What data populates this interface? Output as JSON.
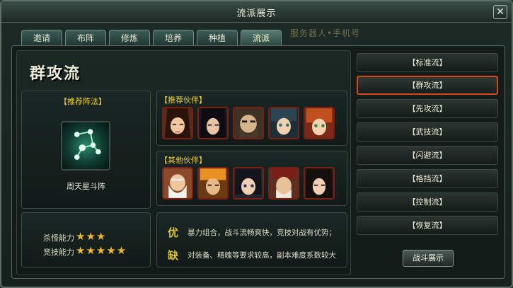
{
  "window": {
    "title": "流派展示",
    "close_icon": "close-icon"
  },
  "tabs": [
    {
      "label": "邀请"
    },
    {
      "label": "布阵"
    },
    {
      "label": "修炼"
    },
    {
      "label": "培养"
    },
    {
      "label": "种植"
    },
    {
      "label": "流派",
      "active": true
    }
  ],
  "background_text": "服务器人•手机号",
  "main": {
    "style_title": "群攻流",
    "recommended_formation": {
      "label": "【推荐阵法】",
      "name": "周天星斗阵"
    },
    "recommended_partners": {
      "label": "【推荐伙伴】",
      "count": 5
    },
    "other_partners": {
      "label": "【其他伙伴】",
      "count": 5
    },
    "ratings": [
      {
        "label": "杀怪能力",
        "stars": 3,
        "display": "★★★"
      },
      {
        "label": "竞技能力",
        "stars": 5,
        "display": "★★★★★"
      }
    ],
    "descriptions": [
      {
        "icon_text": "优",
        "text": "暴力组合，战斗流畅爽快，竞技对战有优势；"
      },
      {
        "icon_text": "缺",
        "text": "对装备、精魄等要求较高，副本难度系数较大"
      }
    ]
  },
  "style_list": [
    {
      "label": "【标准流】"
    },
    {
      "label": "【群攻流】",
      "selected": true
    },
    {
      "label": "【先攻流】"
    },
    {
      "label": "【武技流】"
    },
    {
      "label": "【闪避流】"
    },
    {
      "label": "【格挡流】"
    },
    {
      "label": "【控制流】"
    },
    {
      "label": "【恢复流】"
    }
  ],
  "battle_button": {
    "label": "战斗展示"
  },
  "colors": {
    "accent_gold": "#f2d23b",
    "selected_border": "#d6461e",
    "star": "#f0b72c"
  }
}
